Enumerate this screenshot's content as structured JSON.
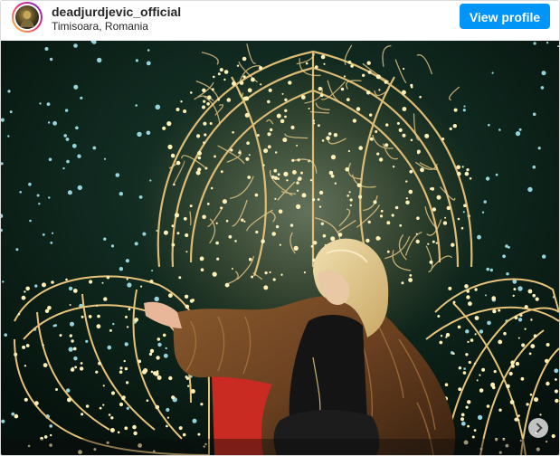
{
  "header": {
    "username": "deadjurdjevic_official",
    "location": "Timisoara, Romania",
    "view_profile_label": "View profile"
  },
  "photo": {
    "description_icon": "christmas-lights-photo",
    "has_next": true
  },
  "colors": {
    "button": "#0095f6",
    "lights_warm": "#ffd98a",
    "lights_cool": "#aef4ff",
    "tree_dark": "#0f2a20"
  }
}
